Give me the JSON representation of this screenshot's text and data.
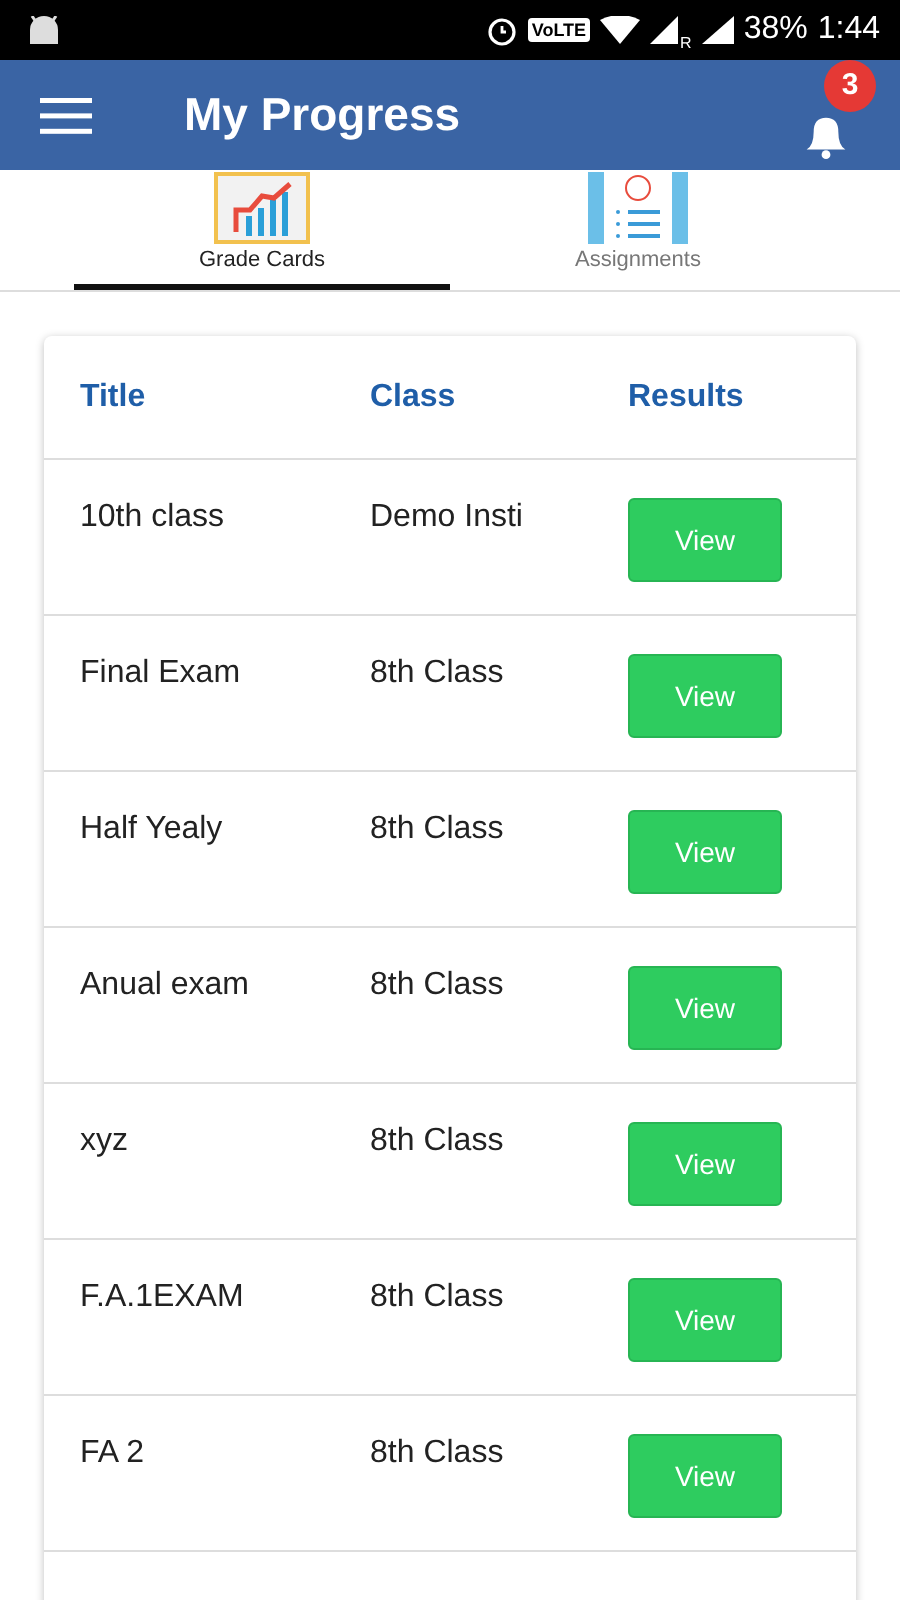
{
  "status_bar": {
    "volte": "VoLTE",
    "roaming": "R",
    "battery": "38%",
    "time": "1:44"
  },
  "app_bar": {
    "title": "My Progress",
    "notification_count": "3"
  },
  "tabs": [
    {
      "label": "Grade Cards",
      "kind": "chart",
      "selected": true
    },
    {
      "label": "Assignments",
      "kind": "list",
      "selected": false
    }
  ],
  "table": {
    "columns": [
      "Title",
      "Class",
      "Results"
    ],
    "rows": [
      {
        "title": "10th class",
        "class": "Demo Insti",
        "action": "View"
      },
      {
        "title": "Final Exam",
        "class": "8th Class",
        "action": "View"
      },
      {
        "title": "Half Yealy",
        "class": "8th Class",
        "action": "View"
      },
      {
        "title": "Anual exam",
        "class": "8th Class",
        "action": "View"
      },
      {
        "title": "xyz",
        "class": "8th Class",
        "action": "View"
      },
      {
        "title": "F.A.1EXAM",
        "class": "8th Class",
        "action": "View"
      },
      {
        "title": "FA 2",
        "class": "8th Class",
        "action": "View"
      }
    ]
  }
}
